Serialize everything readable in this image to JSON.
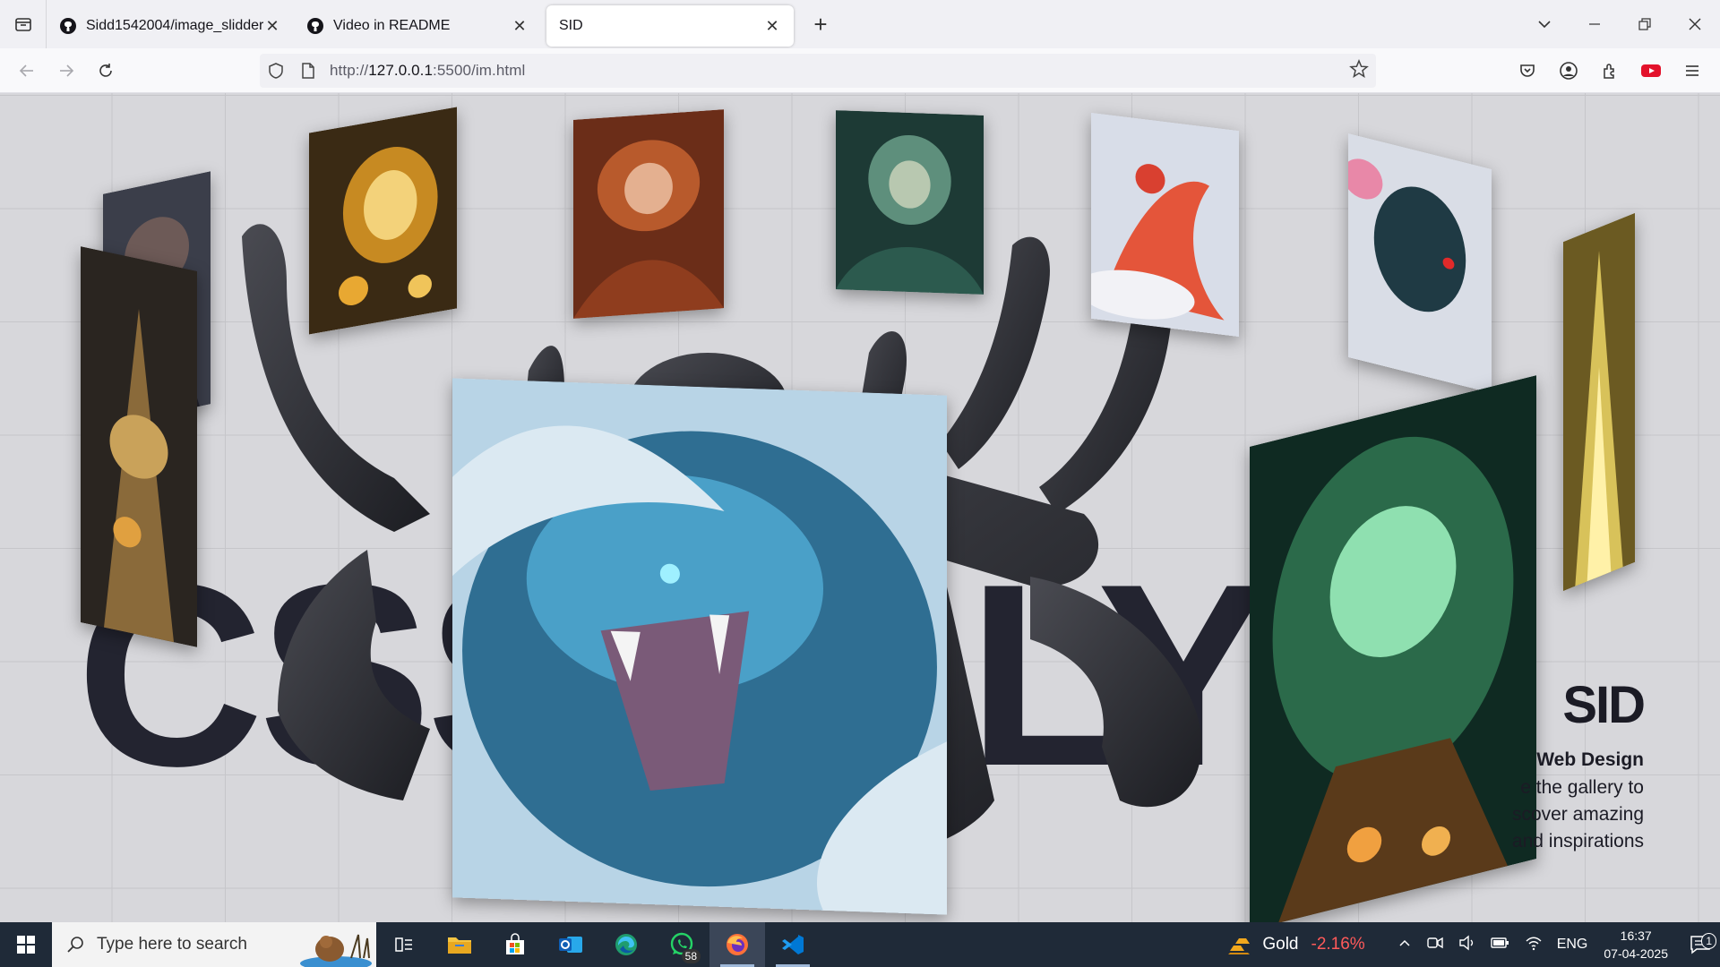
{
  "browser": {
    "tabs": [
      {
        "title": "Sidd1542004/image_slidder",
        "icon": "github-icon"
      },
      {
        "title": "Video in README",
        "icon": "github-icon"
      },
      {
        "title": "SID",
        "icon": "none",
        "active": true
      }
    ],
    "url_prefix": "http://",
    "url_host": "127.0.0.1",
    "url_rest": ":5500/im.html"
  },
  "page": {
    "big_text_left": "CSS",
    "big_text_right": "LY",
    "side_title": "SID",
    "side_subtitle": "Web Design",
    "side_desc_lines": [
      "e the gallery to",
      "scover amazing",
      "and inspirations"
    ]
  },
  "taskbar": {
    "search_placeholder": "Type here to search",
    "whatsapp_badge": "58",
    "gold_label": "Gold",
    "gold_change": "-2.16%",
    "language": "ENG",
    "time": "16:37",
    "date": "07-04-2025",
    "notifications": "1"
  },
  "colors": {
    "accent_text": "#232430",
    "gold_negative": "#ff5a5a",
    "taskbar_bg": "#1f2a38"
  }
}
